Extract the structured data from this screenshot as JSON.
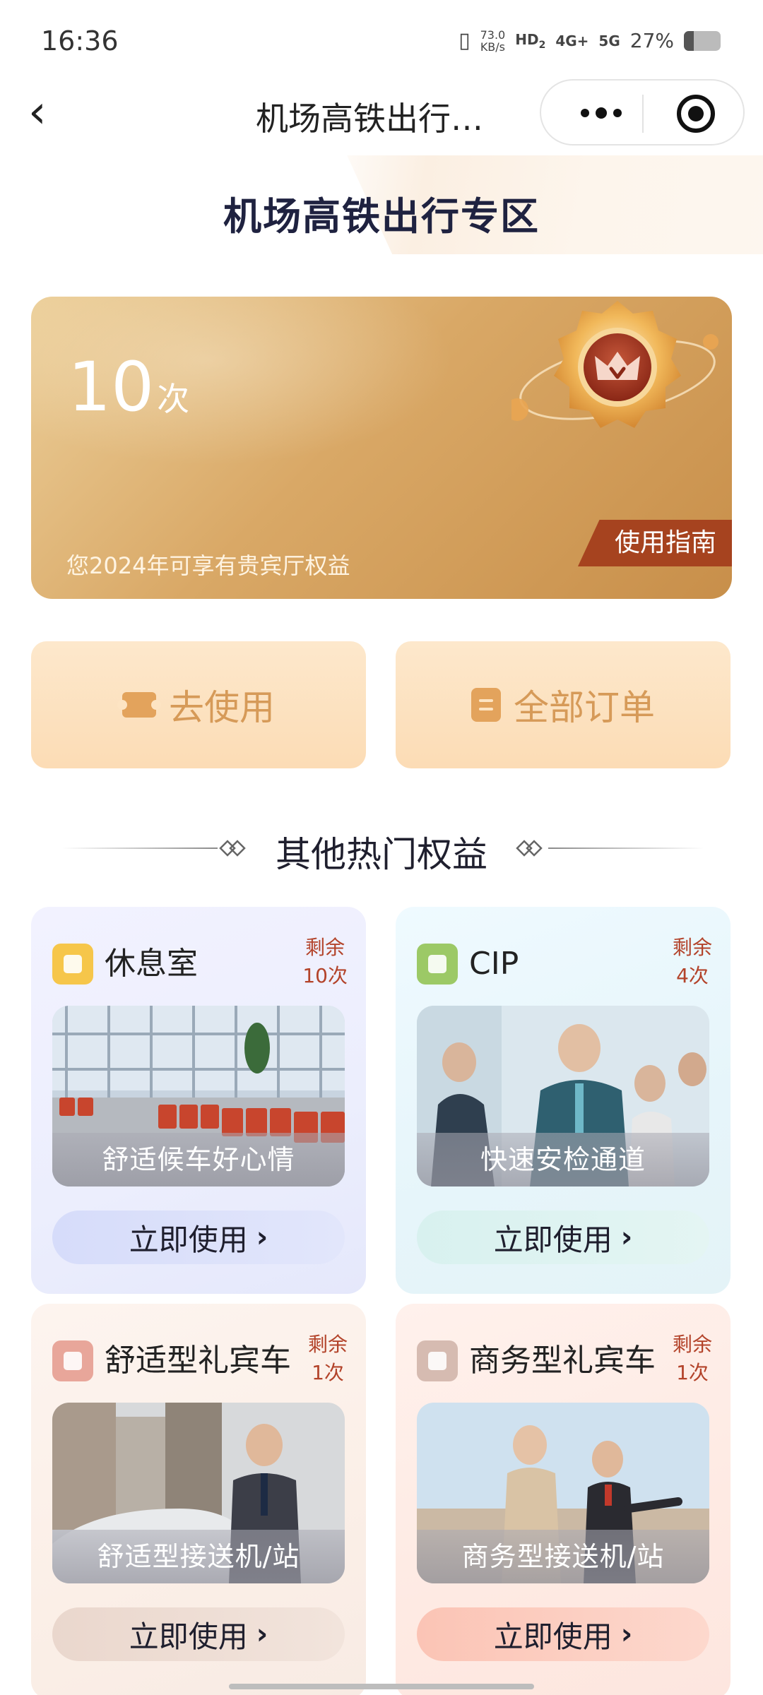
{
  "status_bar": {
    "time": "16:36",
    "net_speed_value": "73.0",
    "net_speed_unit": "KB/s",
    "hd": "HD",
    "hd_sub": "2",
    "net1": "4G+",
    "net2": "5G",
    "battery": "27%",
    "battery_level": 0.27
  },
  "nav": {
    "back_icon": "chevron-left",
    "title": "机场高铁出行…",
    "more_icon": "more-dots",
    "target_icon": "target-circle"
  },
  "header": {
    "title": "机场高铁出行专区"
  },
  "benefit": {
    "count": "10",
    "unit": "次",
    "description": "您2024年可享有贵宾厅权益",
    "guide_label": "使用指南",
    "badge_icon": "crown-v-badge"
  },
  "actions": [
    {
      "label": "去使用",
      "icon": "ticket-icon"
    },
    {
      "label": "全部订单",
      "icon": "order-icon"
    }
  ],
  "section": {
    "title": "其他热门权益"
  },
  "services": [
    {
      "name": "休息室",
      "remain_label": "剩余",
      "remain_count": "10次",
      "caption": "舒适候车好心情",
      "button": "立即使用",
      "icon": "sofa-icon"
    },
    {
      "name": "CIP",
      "remain_label": "剩余",
      "remain_count": "4次",
      "caption": "快速安检通道",
      "button": "立即使用",
      "icon": "id-card-icon"
    },
    {
      "name": "舒适型礼宾车",
      "remain_label": "剩余",
      "remain_count": "1次",
      "caption": "舒适型接送机/站",
      "button": "立即使用",
      "icon": "bus-icon"
    },
    {
      "name": "商务型礼宾车",
      "remain_label": "剩余",
      "remain_count": "1次",
      "caption": "商务型接送机/站",
      "button": "立即使用",
      "icon": "car-icon"
    }
  ],
  "colors": {
    "gold_card": "#d9a866",
    "guide_button": "#a6431f",
    "action_text": "#d69a58",
    "remain_text": "#b3432a"
  }
}
